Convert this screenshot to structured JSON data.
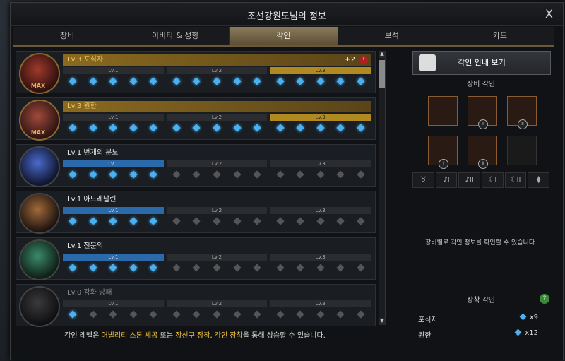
{
  "window": {
    "title": "조선강원도님의 정보",
    "close": "X"
  },
  "tabs": [
    "장비",
    "아바타 & 성향",
    "각인",
    "보석",
    "카드"
  ],
  "active_tab": 2,
  "engravings": [
    {
      "name": "Lv.3 포식자",
      "levels": [
        "Lv.1",
        "Lv.2",
        "Lv.3"
      ],
      "active_level": 3,
      "max": "MAX",
      "plus": "+2",
      "alert": "!",
      "style": "gold"
    },
    {
      "name": "Lv.3 원한",
      "levels": [
        "Lv.1",
        "Lv.2",
        "Lv.3"
      ],
      "active_level": 3,
      "max": "MAX",
      "style": "gold"
    },
    {
      "name": "Lv.1 번개의 분노",
      "levels": [
        "Lv.1",
        "Lv.2",
        "Lv.3"
      ],
      "active_level": 1,
      "style": "normal"
    },
    {
      "name": "Lv.1 아드레날린",
      "levels": [
        "Lv.1",
        "Lv.2",
        "Lv.3"
      ],
      "active_level": 1,
      "style": "normal"
    },
    {
      "name": "Lv.1 전문의",
      "levels": [
        "Lv.1",
        "Lv.2",
        "Lv.3"
      ],
      "active_level": 1,
      "style": "normal"
    },
    {
      "name": "Lv.0 강화 방패",
      "levels": [
        "Lv.1",
        "Lv.2",
        "Lv.3"
      ],
      "active_level": 0,
      "style": "dim"
    }
  ],
  "footer": {
    "p1": "각인 레벨은 ",
    "h1": "어빌리티 스톤 세공",
    "p2": " 또는 ",
    "h2": "장신구 장착",
    "p3": ", ",
    "h3": "각인 장착",
    "p4": "을 통해 상승할 수 있습니다."
  },
  "right": {
    "guide_button": "각인 안내 보기",
    "equip_section": "장비 각인",
    "slot_numerals": [
      "I",
      "II",
      "I",
      "II"
    ],
    "filters": [
      "♉",
      "♪I",
      "♪II",
      "☾I",
      "☾II",
      "⧫"
    ],
    "desc": "장비별로 각인 정보를 확인할 수 있습니다.",
    "mounted_section": "장착 각인",
    "help": "?",
    "mounted": [
      {
        "name": "포식자",
        "count": "x9"
      },
      {
        "name": "원한",
        "count": "x12"
      }
    ]
  }
}
